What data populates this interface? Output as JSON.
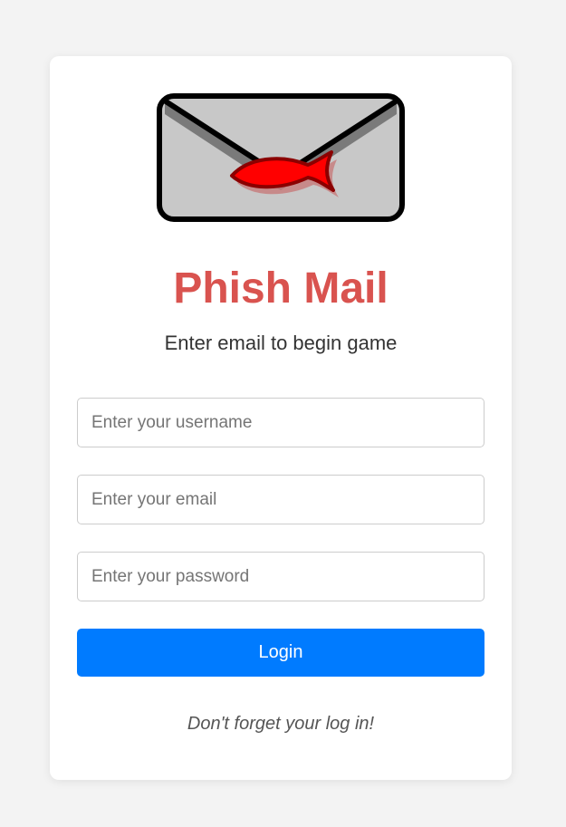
{
  "app": {
    "title": "Phish Mail",
    "subtitle": "Enter email to begin game",
    "logo_icon": "envelope-fish-icon"
  },
  "form": {
    "username_placeholder": "Enter your username",
    "username_value": "",
    "email_placeholder": "Enter your email",
    "email_value": "",
    "password_placeholder": "Enter your password",
    "password_value": "",
    "login_label": "Login"
  },
  "footer": {
    "reminder": "Don't forget your log in!"
  },
  "colors": {
    "background": "#f3f3f3",
    "card": "#ffffff",
    "title": "#d9534f",
    "button": "#007bff",
    "fish": "#ff0000"
  }
}
